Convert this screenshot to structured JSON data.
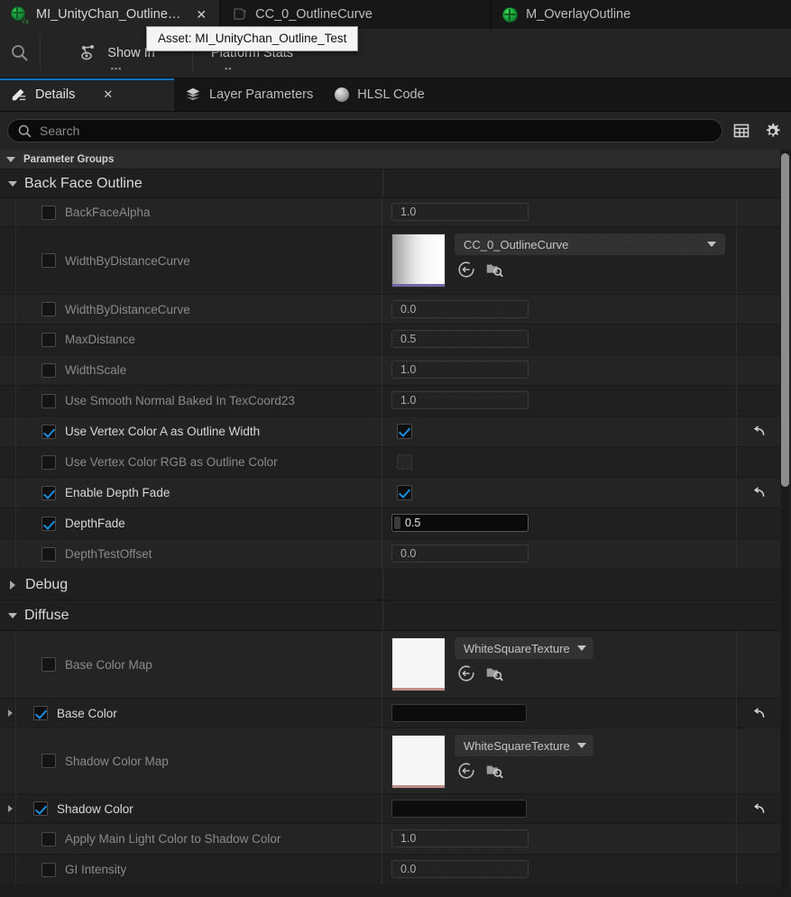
{
  "asset_tabs": [
    {
      "label": "MI_UnityChan_Outline…",
      "icon": "material-instance-icon",
      "active": true,
      "closable": true
    },
    {
      "label": "CC_0_OutlineCurve",
      "icon": "curve-asset-icon",
      "active": false,
      "closable": false
    },
    {
      "label": "M_OverlayOutline",
      "icon": "material-icon",
      "active": false,
      "closable": false
    }
  ],
  "tooltip": {
    "text": "Asset: MI_UnityChan_Outline_Test"
  },
  "toolbar": {
    "search_icon": "search-icon",
    "show_in_label": "Show In",
    "platform_stats_label": "Platform Stats"
  },
  "panel_tabs": [
    {
      "label": "Details",
      "icon": "details-pencil-icon",
      "active": true,
      "closable": true
    },
    {
      "label": "Layer Parameters",
      "icon": "layers-icon",
      "active": false,
      "closable": false
    },
    {
      "label": "HLSL Code",
      "icon": "hlsl-sphere-icon",
      "active": false,
      "closable": false
    }
  ],
  "search": {
    "placeholder": "Search",
    "value": ""
  },
  "search_buttons": [
    {
      "name": "column-view-button",
      "icon": "table-icon"
    },
    {
      "name": "settings-button",
      "icon": "gear-icon"
    }
  ],
  "category": {
    "label": "Parameter Groups",
    "expanded": true
  },
  "groups": [
    {
      "label": "Back Face Outline",
      "expanded": true,
      "rows": [
        {
          "name": "BackFaceAlpha",
          "enabled": false,
          "type": "number",
          "value": "1.0"
        },
        {
          "name": "WidthByDistanceCurve",
          "enabled": false,
          "type": "texture",
          "asset": "CC_0_OutlineCurve",
          "thumb": "gradient"
        },
        {
          "name": "WidthByDistanceCurve",
          "enabled": false,
          "type": "number",
          "value": "0.0"
        },
        {
          "name": "MaxDistance",
          "enabled": false,
          "type": "number",
          "value": "0.5"
        },
        {
          "name": "WidthScale",
          "enabled": false,
          "type": "number",
          "value": "1.0"
        },
        {
          "name": "Use Smooth Normal Baked In TexCoord23",
          "enabled": false,
          "type": "number",
          "value": "1.0"
        },
        {
          "name": "Use Vertex Color A as Outline Width",
          "enabled": true,
          "type": "checkbox",
          "checked": true,
          "reset": true
        },
        {
          "name": "Use Vertex Color RGB as Outline Color",
          "enabled": false,
          "type": "checkbox",
          "checked": false,
          "reset": false
        },
        {
          "name": "Enable Depth Fade",
          "enabled": true,
          "type": "checkbox",
          "checked": true,
          "reset": true
        },
        {
          "name": "DepthFade",
          "enabled": true,
          "type": "number",
          "value": "0.5",
          "editing": true
        },
        {
          "name": "DepthTestOffset",
          "enabled": false,
          "type": "number",
          "value": "0.0"
        }
      ]
    },
    {
      "label": "Debug",
      "expanded": false,
      "rows": []
    },
    {
      "label": "Diffuse",
      "expanded": true,
      "rows": [
        {
          "name": "Base Color Map",
          "enabled": false,
          "type": "texture",
          "asset": "WhiteSquareTexture",
          "thumb": "white"
        },
        {
          "name": "Base Color",
          "enabled": true,
          "type": "color",
          "swatch": "#0c0c0c",
          "expandable": true,
          "reset": true
        },
        {
          "name": "Shadow Color Map",
          "enabled": false,
          "type": "texture",
          "asset": "WhiteSquareTexture",
          "thumb": "white"
        },
        {
          "name": "Shadow Color",
          "enabled": true,
          "type": "color",
          "swatch": "#0c0c0c",
          "expandable": true,
          "reset": true
        },
        {
          "name": "Apply Main Light Color to Shadow Color",
          "enabled": false,
          "type": "number",
          "value": "1.0"
        },
        {
          "name": "GI Intensity",
          "enabled": false,
          "type": "number",
          "value": "0.0"
        }
      ]
    }
  ],
  "colors": {
    "accent_blue": "#1a8fe3",
    "tab_active_underline": "#0d75c4",
    "panel_bg": "#242424",
    "row_alt": "#202020"
  }
}
